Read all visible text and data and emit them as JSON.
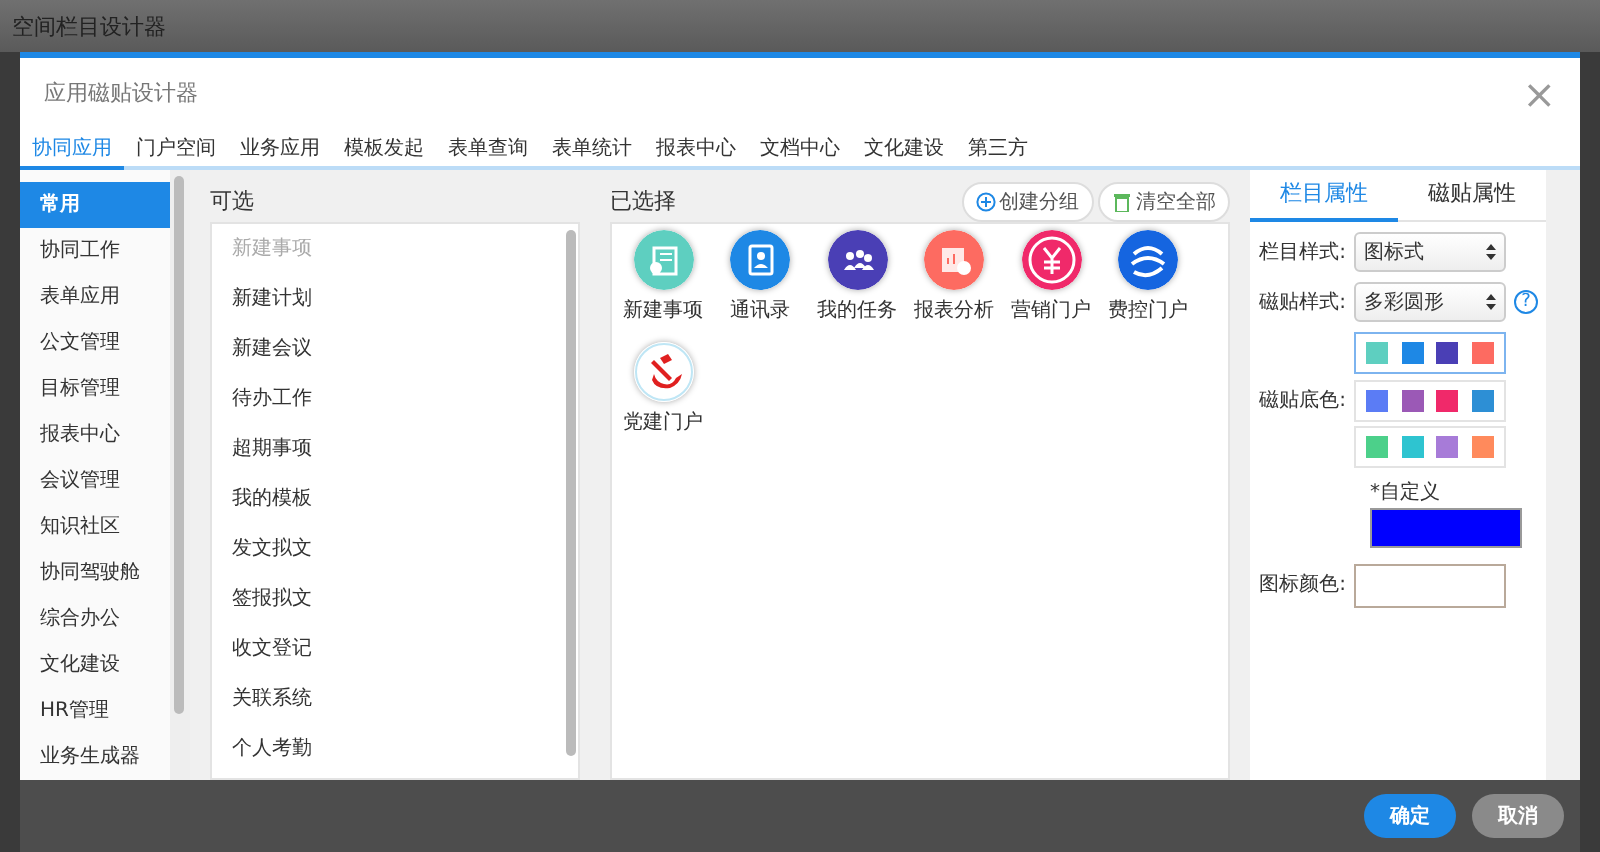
{
  "window": {
    "title": "空间栏目设计器"
  },
  "dialog": {
    "title": "应用磁贴设计器",
    "close": "×"
  },
  "tabs": [
    {
      "label": "协同应用",
      "selected": true
    },
    {
      "label": "门户空间",
      "selected": false
    },
    {
      "label": "业务应用",
      "selected": false
    },
    {
      "label": "模板发起",
      "selected": false
    },
    {
      "label": "表单查询",
      "selected": false
    },
    {
      "label": "表单统计",
      "selected": false
    },
    {
      "label": "报表中心",
      "selected": false
    },
    {
      "label": "文档中心",
      "selected": false
    },
    {
      "label": "文化建设",
      "selected": false
    },
    {
      "label": "第三方",
      "selected": false
    }
  ],
  "sidebar": {
    "items": [
      {
        "label": "常用",
        "selected": true
      },
      {
        "label": "协同工作",
        "selected": false
      },
      {
        "label": "表单应用",
        "selected": false
      },
      {
        "label": "公文管理",
        "selected": false
      },
      {
        "label": "目标管理",
        "selected": false
      },
      {
        "label": "报表中心",
        "selected": false
      },
      {
        "label": "会议管理",
        "selected": false
      },
      {
        "label": "知识社区",
        "selected": false
      },
      {
        "label": "协同驾驶舱",
        "selected": false
      },
      {
        "label": "综合办公",
        "selected": false
      },
      {
        "label": "文化建设",
        "selected": false
      },
      {
        "label": "HR管理",
        "selected": false
      },
      {
        "label": "业务生成器",
        "selected": false
      }
    ]
  },
  "available": {
    "heading": "可选",
    "items": [
      {
        "label": "新建事项",
        "disabled": true
      },
      {
        "label": "新建计划",
        "disabled": false
      },
      {
        "label": "新建会议",
        "disabled": false
      },
      {
        "label": "待办工作",
        "disabled": false
      },
      {
        "label": "超期事项",
        "disabled": false
      },
      {
        "label": "我的模板",
        "disabled": false
      },
      {
        "label": "发文拟文",
        "disabled": false
      },
      {
        "label": "签报拟文",
        "disabled": false
      },
      {
        "label": "收文登记",
        "disabled": false
      },
      {
        "label": "关联系统",
        "disabled": false
      },
      {
        "label": "个人考勤",
        "disabled": false
      }
    ]
  },
  "selected_panel": {
    "heading": "已选择",
    "buttons": [
      {
        "label": "创建分组",
        "kind": "add"
      },
      {
        "label": "清空全部",
        "kind": "clear"
      }
    ],
    "tiles": [
      {
        "label": "新建事项",
        "kind": "document",
        "color": "#5ecfc0"
      },
      {
        "label": "通讯录",
        "kind": "contacts",
        "color": "#1e88e5"
      },
      {
        "label": "我的任务",
        "kind": "people",
        "color": "#4a3fb5"
      },
      {
        "label": "报表分析",
        "kind": "chart",
        "color": "#fd6b61"
      },
      {
        "label": "营销门户",
        "kind": "yen",
        "color": "#f0296a"
      },
      {
        "label": "费控门户",
        "kind": "swirl",
        "color": "#1565e0"
      },
      {
        "label": "党建门户",
        "kind": "emblem",
        "color": "#ffffff"
      }
    ]
  },
  "properties": {
    "tabs": [
      {
        "label": "栏目属性",
        "selected": true
      },
      {
        "label": "磁贴属性",
        "selected": false
      }
    ],
    "column_style": {
      "label": "栏目样式:",
      "value": "图标式"
    },
    "tile_style": {
      "label": "磁贴样式:",
      "value": "多彩圆形",
      "help": "?"
    },
    "tile_color": {
      "label": "磁贴底色:",
      "palettes": [
        {
          "selected": true,
          "swatches": [
            {
              "color": "#5ecfc0"
            },
            {
              "color": "#1e88e5"
            },
            {
              "color": "#4a3fb5"
            },
            {
              "color": "#fd6b61"
            }
          ]
        },
        {
          "selected": false,
          "swatches": [
            {
              "color": "#5b7cf5"
            },
            {
              "color": "#9b59b6"
            },
            {
              "color": "#f0296a"
            },
            {
              "color": "#2d8fd5"
            }
          ]
        },
        {
          "selected": false,
          "swatches": [
            {
              "color": "#4cd08a"
            },
            {
              "color": "#2ec4d0"
            },
            {
              "color": "#a77bd8"
            },
            {
              "color": "#ff8a5c"
            }
          ]
        }
      ],
      "custom": {
        "label": "*自定义",
        "color": "#0000ff"
      }
    },
    "icon_color": {
      "label": "图标颜色:",
      "color": "#ffffff"
    }
  },
  "footer": {
    "buttons": [
      {
        "label": "确定",
        "kind": "primary"
      },
      {
        "label": "取消",
        "kind": "secondary"
      }
    ]
  }
}
